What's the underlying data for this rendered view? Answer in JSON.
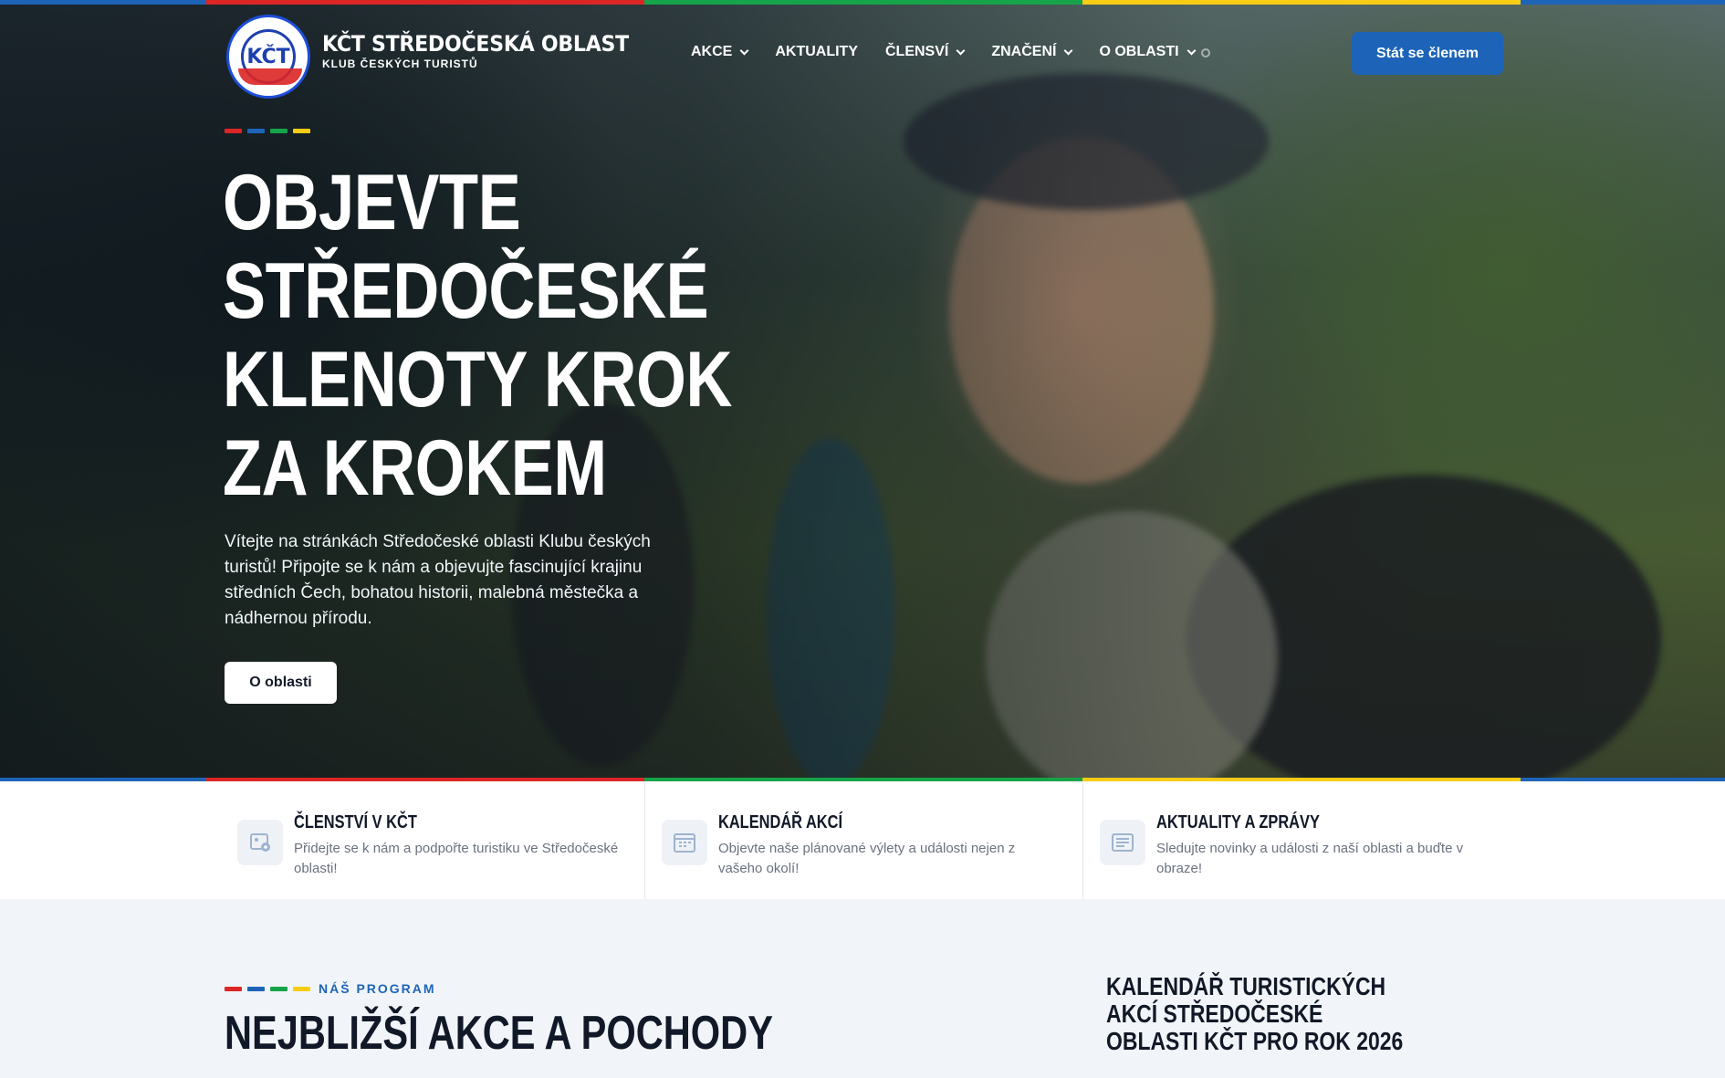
{
  "colors": {
    "red": "#dc2626",
    "blue": "#1d64b8",
    "green": "#16a34a",
    "yellow": "#facc15",
    "dark": "#111827"
  },
  "brand": {
    "logo_text": "KČT",
    "logo_ring_text": "KLUB ČESKÝCH TURISTŮ · STŘEDOČESKÁ OBLAST",
    "title": "KČT STŘEDOČESKÁ OBLAST",
    "subtitle": "KLUB ČESKÝCH TURISTŮ"
  },
  "nav": {
    "items": [
      {
        "label": "AKCE",
        "has_dropdown": true
      },
      {
        "label": "AKTUALITY",
        "has_dropdown": false
      },
      {
        "label": "ČLENSVÍ",
        "has_dropdown": true
      },
      {
        "label": "ZNAČENÍ",
        "has_dropdown": true
      },
      {
        "label": "O OBLASTI",
        "has_dropdown": true
      }
    ],
    "search_icon": "search-icon",
    "cta_label": "Stát se členem"
  },
  "hero": {
    "title": "OBJEVTE STŘEDOČESKÉ KLENOTY KROK ZA KROKEM",
    "description": "Vítejte na stránkách Středočeské oblasti Klubu českých turistů! Připojte se k nám a objevujte fascinující krajinu středních Čech, bohatou historii, malebná městečka a nádhernou přírodu.",
    "button_label": "O oblasti"
  },
  "features": [
    {
      "icon": "membership-icon",
      "title": "ČLENSTVÍ V KČT",
      "text": "Přidejte se k nám a podpořte turistiku ve Středočeské oblasti!"
    },
    {
      "icon": "calendar-icon",
      "title": "KALENDÁŘ AKCÍ",
      "text": "Objevte naše plánované výlety a události nejen z vašeho okolí!"
    },
    {
      "icon": "news-icon",
      "title": "AKTUALITY A ZPRÁVY",
      "text": "Sledujte novinky a události z naší oblasti a buďte v obraze!"
    }
  ],
  "program": {
    "kicker": "NÁŠ PROGRAM",
    "title": "NEJBLIŽŠÍ AKCE A POCHODY",
    "calendar_title": "KALENDÁŘ TURISTICKÝCH AKCÍ STŘEDOČESKÉ OBLASTI KČT PRO ROK 2026"
  }
}
